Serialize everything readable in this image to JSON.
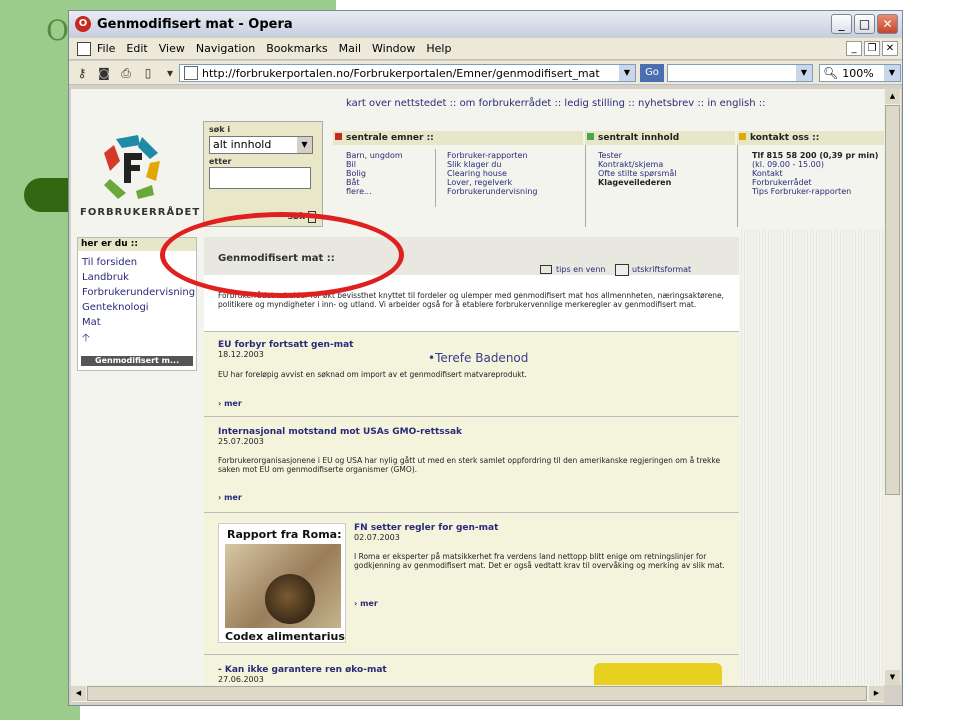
{
  "slide": {
    "letter": "O"
  },
  "window": {
    "title": "Genmodifisert mat - Opera"
  },
  "window_buttons": [
    "_",
    "□",
    "✕"
  ],
  "menu": [
    "File",
    "Edit",
    "View",
    "Navigation",
    "Bookmarks",
    "Mail",
    "Window",
    "Help"
  ],
  "address": {
    "url": "http://forbrukerportalen.no/Forbrukerportalen/Emner/genmodifisert_mat",
    "go_label": "Go",
    "zoom": "100%"
  },
  "site": {
    "topnav": "kart over nettstedet  ::  om forbrukerrådet  ::  ledig stilling  ::  nyhetsbrev  ::  in english  ::",
    "logo_text": "FORBRUKERRÅDET",
    "search": {
      "label_in": "søk i",
      "select_value": "alt innhold",
      "label_after": "etter",
      "button": "søk"
    },
    "sections": {
      "sentrale_emner": "sentrale emner ::",
      "sentralt_innhold": "sentralt innhold",
      "kontakt_oss": "kontakt oss ::"
    },
    "col1": [
      "Barn, ungdom",
      "Bil",
      "Bolig",
      "Båt",
      "flere..."
    ],
    "col2": [
      "Forbruker-rapporten",
      "Slik klager du",
      "Clearing house",
      "Lover, regelverk",
      "Forbrukerundervisning"
    ],
    "col3": [
      "Tester",
      "Kontrakt/skjema",
      "Ofte stilte spørsmål",
      "Klageveilederen"
    ],
    "col4": [
      "Tlf 815 58 200 (0,39 pr min)",
      "(kl. 09.00 - 15.00)",
      "Kontakt",
      "Forbrukerrådet",
      "Tips Forbruker-rapporten"
    ],
    "herdu": {
      "title": "her er du ::",
      "links": [
        "Til forsiden",
        "Landbruk",
        "Forbrukerundervisning",
        "Genteknologi",
        "Mat"
      ],
      "current": "Genmodifisert m..."
    },
    "main": {
      "title": "Genmodifisert mat ::",
      "tips": "tips en venn",
      "print": "utskriftsformat",
      "intro": "Forbrukerrådet arbeider for økt bevissthet knyttet til fordeler og ulemper med genmodifisert mat hos allmennheten, næringsaktørene, politikere og myndigheter i inn- og utland. Vi arbeider også for å etablere forbrukervennlige merkeregler av genmodifisert mat."
    },
    "articles": [
      {
        "title": "EU forbyr fortsatt gen-mat",
        "date": "18.12.2003",
        "text": "EU har foreløpig avvist en søknad om import av et genmodifisert matvareprodukt.",
        "more": "mer"
      },
      {
        "title": "Internasjonal motstand mot USAs GMO-rettssak",
        "date": "25.07.2003",
        "text": "Forbrukerorganisasjonene i EU og USA har nylig gått ut med en sterk samlet oppfordring til den amerikanske regjeringen om å trekke saken mot EU om genmodifiserte organismer (GMO).",
        "more": "mer"
      },
      {
        "title": "FN setter regler for gen-mat",
        "date": "02.07.2003",
        "text": "I Roma er eksperter på matsikkerhet fra verdens land nettopp blitt enige om retningslinjer for godkjenning av genmodifisert mat. Det er også vedtatt krav til overvåking og merking av slik mat.",
        "more": "mer",
        "image_top": "Rapport fra Roma:",
        "image_bottom": "Codex alimentarius"
      },
      {
        "title": "- Kan ikke garantere ren øko-mat",
        "date": "27.06.2003"
      }
    ]
  },
  "overlay_text": "•Terefe Badenod"
}
